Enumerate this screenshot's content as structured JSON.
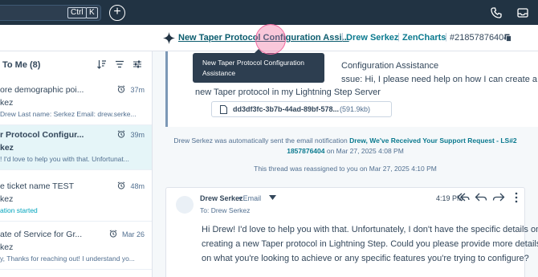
{
  "topbar": {
    "search_shortcut_ctrl": "Ctrl",
    "search_shortcut_key": "K",
    "create_label": "+"
  },
  "header": {
    "title": "New Taper Protocol Configuration Assi...",
    "sep1": "|",
    "contact": "Drew Serkez",
    "sep2": "|",
    "company": "ZenCharts",
    "sep3": "|",
    "ticket_id": "#21857876404"
  },
  "tooltip": {
    "line1": "New Taper Protocol Configuration",
    "line2": "Assistance"
  },
  "sidebar": {
    "heading": "To Me (8)",
    "items": [
      {
        "title": "ore demographic poi...",
        "who": "kez",
        "preview": "Drew Last name: Serkez Email: drew.serke...",
        "time": "37m"
      },
      {
        "title": "r Protocol Configur...",
        "who": "kez",
        "preview": "! I'd love to help you with that. Unfortunat...",
        "time": "39m"
      },
      {
        "title": "e ticket name TEST",
        "who": "kez",
        "preview": "ation started",
        "time": "48m"
      },
      {
        "title": "ate of Service for Gr...",
        "who": "kez",
        "preview": "y, Thanks for reaching out! I understand yo...",
        "time": "Mar 26"
      }
    ]
  },
  "email": {
    "subject_tail": "Configuration Assistance",
    "issue_tail": "ssue: Hi, I please need help on how I can create a",
    "line3": "new Taper protocol in my Lightning Step Server",
    "attachment_name": "dd3df3fc-3b7b-44ad-89bf-578...",
    "attachment_size": "(591.9kb)"
  },
  "notification": {
    "prefix": "Drew Serkez was automatically sent the email notification",
    "link_a": "Drew, We've Received Your Support Request - LS#2",
    "link_b": "1857876404",
    "suffix": " on Mar 27, 2025 4:08 PM",
    "reassigned": "This thread was reassigned to you on Mar 27, 2025 4:10 PM"
  },
  "reply": {
    "sender": "Drew Serkez",
    "channel": "• Email",
    "to": "To: Drew Serkez",
    "time": "4:19 PM",
    "body_lines": [
      "Hi Drew! I'd love to help you with that. Unfortunately, I don't have the specific details on",
      "creating a new Taper protocol in Lightning Step. Could you please provide more details",
      "on what you're looking to achieve or any specific features you're trying to configure?"
    ]
  },
  "colors": {
    "topbar_bg": "#213343",
    "link_teal": "#0b7a8f",
    "selected_item_bg": "#e5f5f8",
    "tooltip_bg": "#2d3e50",
    "highlight_pink": "#f26aa0"
  }
}
